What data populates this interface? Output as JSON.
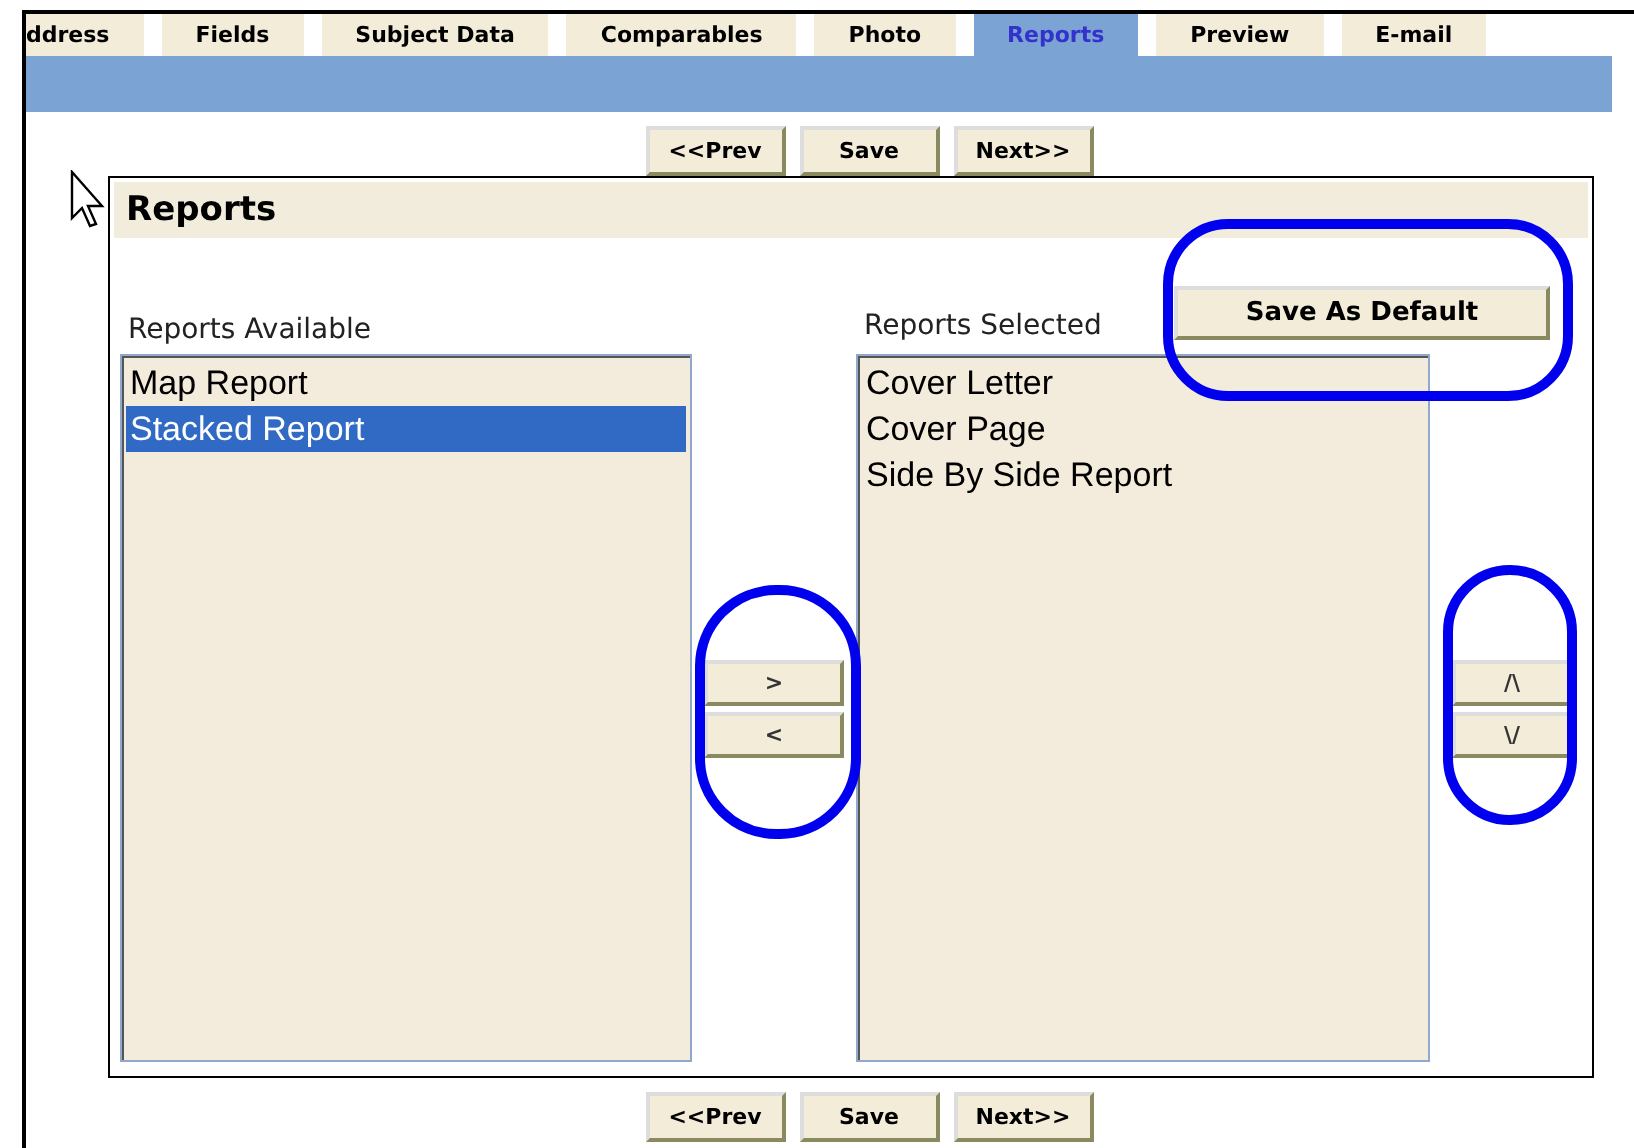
{
  "tabs": [
    {
      "label": "ddress",
      "selected": false
    },
    {
      "label": "Fields",
      "selected": false
    },
    {
      "label": "Subject Data",
      "selected": false
    },
    {
      "label": "Comparables",
      "selected": false
    },
    {
      "label": "Photo",
      "selected": false
    },
    {
      "label": "Reports",
      "selected": true
    },
    {
      "label": "Preview",
      "selected": false
    },
    {
      "label": "E-mail",
      "selected": false
    }
  ],
  "nav_top": [
    "<<Prev",
    "Save",
    "Next>>"
  ],
  "panel": {
    "title": "Reports",
    "available": {
      "label": "Reports Available",
      "items": [
        {
          "label": "Map Report",
          "selected": false
        },
        {
          "label": "Stacked Report",
          "selected": true
        }
      ]
    },
    "move_buttons": [
      ">",
      "<"
    ],
    "selected": {
      "label": "Reports Selected",
      "save_default": "Save As Default",
      "items": [
        {
          "label": "Cover Letter",
          "selected": false
        },
        {
          "label": "Cover Page",
          "selected": false
        },
        {
          "label": "Side By Side Report",
          "selected": false
        }
      ]
    },
    "order_buttons": [
      "/\\",
      "\\/"
    ]
  },
  "nav_bottom": [
    "<<Prev",
    "Save",
    "Next>>"
  ]
}
